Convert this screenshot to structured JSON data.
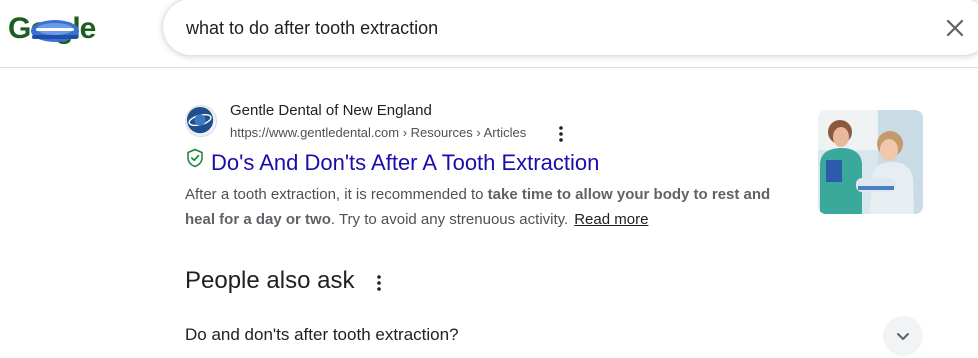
{
  "header": {
    "logo_text": "Go  gle",
    "search_query": "what to do after tooth extraction",
    "icons": {
      "clear": "close-icon"
    }
  },
  "result": {
    "site_name": "Gentle Dental of New England",
    "url": "https://www.gentledental.com › Resources › Articles",
    "title": "Do's And Don'ts After A Tooth Extraction",
    "snippet_part1": "After a tooth extraction, it is recommended to ",
    "snippet_bold": "take time to allow your body to rest and heal for a day or two",
    "snippet_part2": ". Try to avoid any strenuous activity.",
    "read_more": "Read more",
    "icons": {
      "favicon": "saturn-logo-icon",
      "verified": "shield-check-icon",
      "menu": "more-vert-icon"
    }
  },
  "people_also_ask": {
    "title": "People also ask",
    "questions": [
      "Do and don'ts after tooth extraction?"
    ],
    "icons": {
      "menu": "more-vert-icon",
      "expand": "chevron-down-icon"
    }
  },
  "colors": {
    "link": "#1a0dab",
    "logo_green": "#1b5e20",
    "verified_green": "#188038",
    "url_gray": "#4d5156"
  }
}
